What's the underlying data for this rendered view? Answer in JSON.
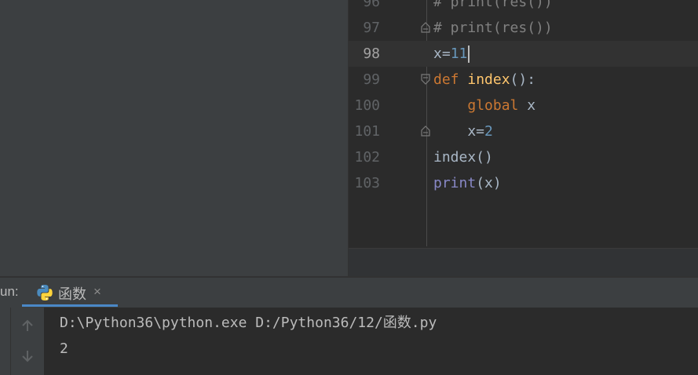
{
  "editor": {
    "lines": [
      {
        "num": "96",
        "segments": [
          {
            "t": "# print(res())",
            "c": "cm"
          }
        ]
      },
      {
        "num": "97",
        "segments": [
          {
            "t": "# print(res())",
            "c": "cm"
          }
        ]
      },
      {
        "num": "98",
        "segments": [
          {
            "t": "x=",
            "c": ""
          },
          {
            "t": "11",
            "c": "num"
          }
        ]
      },
      {
        "num": "99",
        "segments": [
          {
            "t": "def ",
            "c": "kw"
          },
          {
            "t": "index",
            "c": "fn"
          },
          {
            "t": "():",
            "c": ""
          }
        ]
      },
      {
        "num": "100",
        "segments": [
          {
            "t": "    ",
            "c": ""
          },
          {
            "t": "global",
            "c": "kw"
          },
          {
            "t": " x",
            "c": ""
          }
        ]
      },
      {
        "num": "101",
        "segments": [
          {
            "t": "    x=",
            "c": ""
          },
          {
            "t": "2",
            "c": "num"
          }
        ]
      },
      {
        "num": "102",
        "segments": [
          {
            "t": "index()",
            "c": ""
          }
        ]
      },
      {
        "num": "103",
        "segments": [
          {
            "t": "print",
            "c": "bi"
          },
          {
            "t": "(x)",
            "c": ""
          }
        ]
      }
    ],
    "current_line": "98"
  },
  "run": {
    "label": "un:",
    "tab_title": "函数",
    "tab_close": "×",
    "icon": "python-icon"
  },
  "console": {
    "command": "D:\\Python36\\python.exe D:/Python36/12/函数.py",
    "output": "2"
  },
  "toolbar": {
    "up_icon": "arrow-up-icon",
    "down_icon": "arrow-down-icon"
  }
}
